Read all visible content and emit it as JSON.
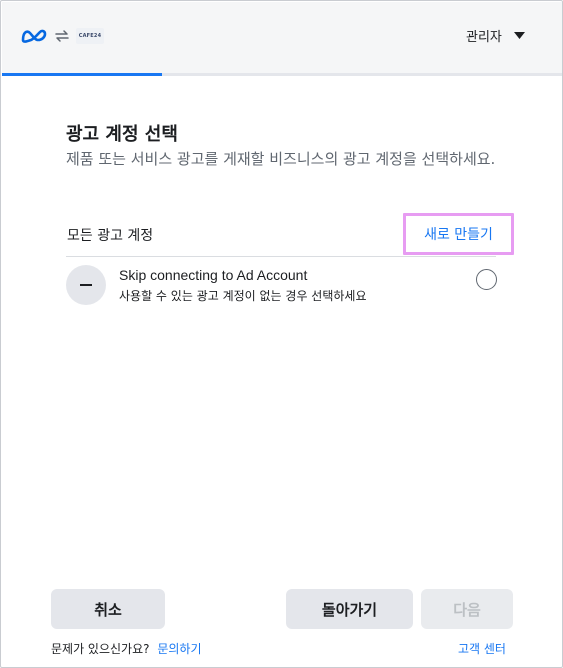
{
  "header": {
    "partner_logo_text": "CAFE24",
    "admin_label": "관리자",
    "progress_fraction": 0.285
  },
  "main": {
    "title": "광고 계정 선택",
    "description": "제품 또는 서비스 광고를 게재할 비즈니스의 광고 계정을 선택하세요.",
    "section_label": "모든 광고 계정",
    "create_new_label": "새로 만들기",
    "options": [
      {
        "title": "Skip connecting to Ad Account",
        "subtitle": "사용할 수 있는 광고 계정이 없는 경우 선택하세요",
        "selected": false
      }
    ]
  },
  "footer": {
    "cancel_label": "취소",
    "back_label": "돌아가기",
    "next_label": "다음",
    "help_text": "문제가 있으신가요?",
    "help_link": "문의하기",
    "support_link": "고객 센터"
  },
  "colors": {
    "accent": "#1877f2",
    "highlight_border": "#e79cf2",
    "button_bg": "#e4e6eb"
  }
}
